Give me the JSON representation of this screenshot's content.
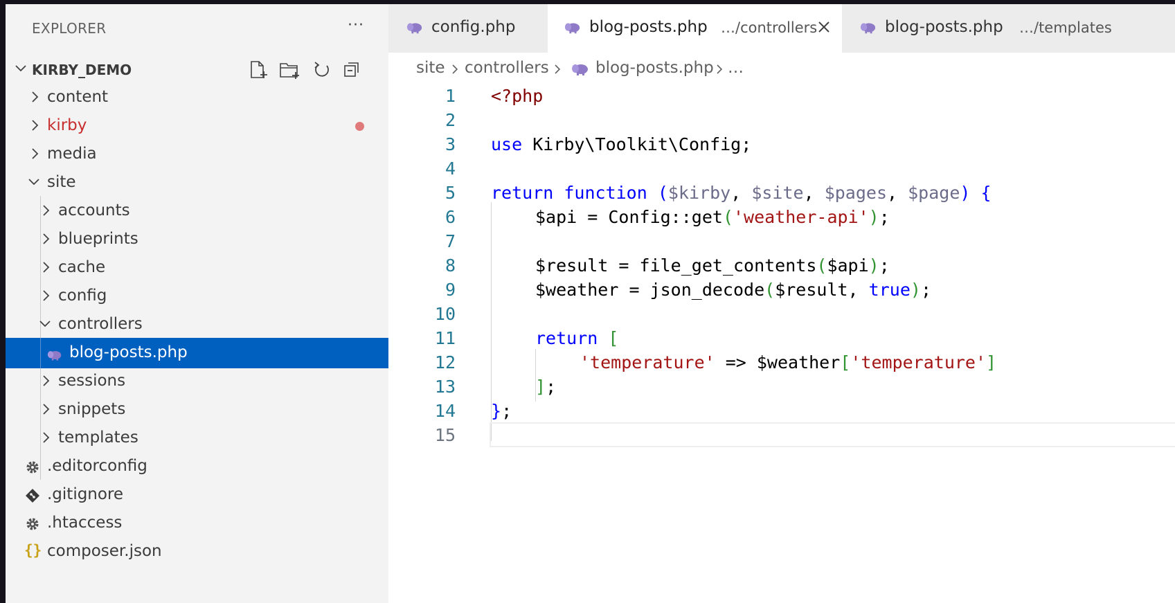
{
  "explorer": {
    "title": "EXPLORER",
    "more_label": "···",
    "project": "KIRBY_DEMO",
    "tree": [
      {
        "label": "content"
      },
      {
        "label": "kirby"
      },
      {
        "label": "media"
      },
      {
        "label": "site"
      },
      {
        "label": "accounts"
      },
      {
        "label": "blueprints"
      },
      {
        "label": "cache"
      },
      {
        "label": "config"
      },
      {
        "label": "controllers"
      },
      {
        "label": "blog-posts.php"
      },
      {
        "label": "sessions"
      },
      {
        "label": "snippets"
      },
      {
        "label": "templates"
      },
      {
        "label": ".editorconfig"
      },
      {
        "label": ".gitignore"
      },
      {
        "label": ".htaccess"
      },
      {
        "label": "composer.json"
      }
    ],
    "colors": {
      "selected_bg": "#0060c0",
      "modified_dot": "#e07a7a",
      "kirby_label": "#c72e2e"
    }
  },
  "tabs": [
    {
      "name": "config.php",
      "desc": ""
    },
    {
      "name": "blog-posts.php",
      "desc": "…/controllers",
      "active": true
    },
    {
      "name": "blog-posts.php",
      "desc": "…/templates"
    }
  ],
  "breadcrumb": {
    "parts": [
      "site",
      "controllers",
      "blog-posts.php",
      "…"
    ]
  },
  "editor": {
    "line_numbers": [
      "1",
      "2",
      "3",
      "4",
      "5",
      "6",
      "7",
      "8",
      "9",
      "10",
      "11",
      "12",
      "13",
      "14",
      "15"
    ],
    "tokens": {
      "l1_open": "<?php",
      "l3_use": "use",
      "l3_rest": " Kirby\\Toolkit\\Config;",
      "l5_return": "return",
      "l5_function": " function ",
      "l5_lparen": "(",
      "l5_kirby": "$kirby",
      "l5_c1": ", ",
      "l5_site": "$site",
      "l5_c2": ", ",
      "l5_pages": "$pages",
      "l5_c3": ", ",
      "l5_page": "$page",
      "l5_rparen": ")",
      "l5_brace": " {",
      "l6_a": "$api = Config::get",
      "l6_lp": "(",
      "l6_str": "'weather-api'",
      "l6_rp": ")",
      "l6_semi": ";",
      "l8_a": "$result = file_get_contents",
      "l8_lp": "(",
      "l8_b": "$api",
      "l8_rp": ")",
      "l8_semi": ";",
      "l9_a": "$weather = json_decode",
      "l9_lp": "(",
      "l9_b": "$result, ",
      "l9_true": "true",
      "l9_rp": ")",
      "l9_semi": ";",
      "l11_return": "return",
      "l11_br": " [",
      "l12_str": "'temperature'",
      "l12_arrow": " => $weather",
      "l12_lb": "[",
      "l12_key": "'temperature'",
      "l12_rb": "]",
      "l13_br": "]",
      "l13_semi": ";",
      "l14_brace": "}",
      "l14_semi": ";"
    }
  }
}
